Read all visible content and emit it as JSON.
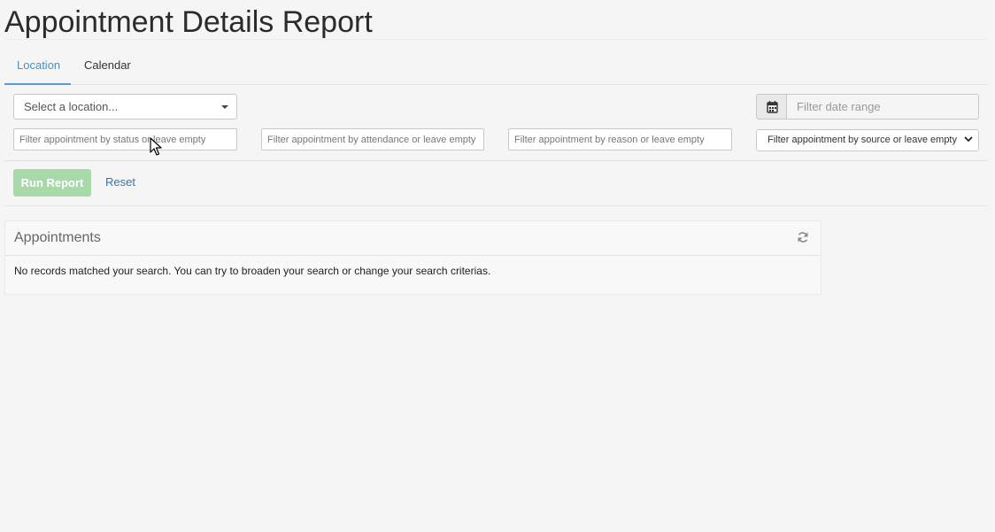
{
  "page": {
    "title": "Appointment Details Report"
  },
  "tabs": [
    {
      "label": "Location",
      "active": true
    },
    {
      "label": "Calendar",
      "active": false
    }
  ],
  "filters": {
    "location_select": {
      "value": "Select a location..."
    },
    "date_range": {
      "placeholder": "Filter date range",
      "icon": "calendar-icon"
    },
    "status": {
      "placeholder": "Filter appointment by status or leave empty"
    },
    "attendance": {
      "placeholder": "Filter appointment by attendance or leave empty"
    },
    "reason": {
      "placeholder": "Filter appointment by reason or leave empty"
    },
    "source": {
      "value": "Filter appointment by source or leave empty"
    }
  },
  "actions": {
    "run_label": "Run Report",
    "reset_label": "Reset"
  },
  "appointments": {
    "title": "Appointments",
    "empty_message": "No records matched your search. You can try to broaden your search or change your search criterias.",
    "refresh_icon": "refresh-icon"
  },
  "colors": {
    "accent": "#5a9bd5",
    "run_button": "#a8d9a8",
    "link": "#3a74a8"
  }
}
